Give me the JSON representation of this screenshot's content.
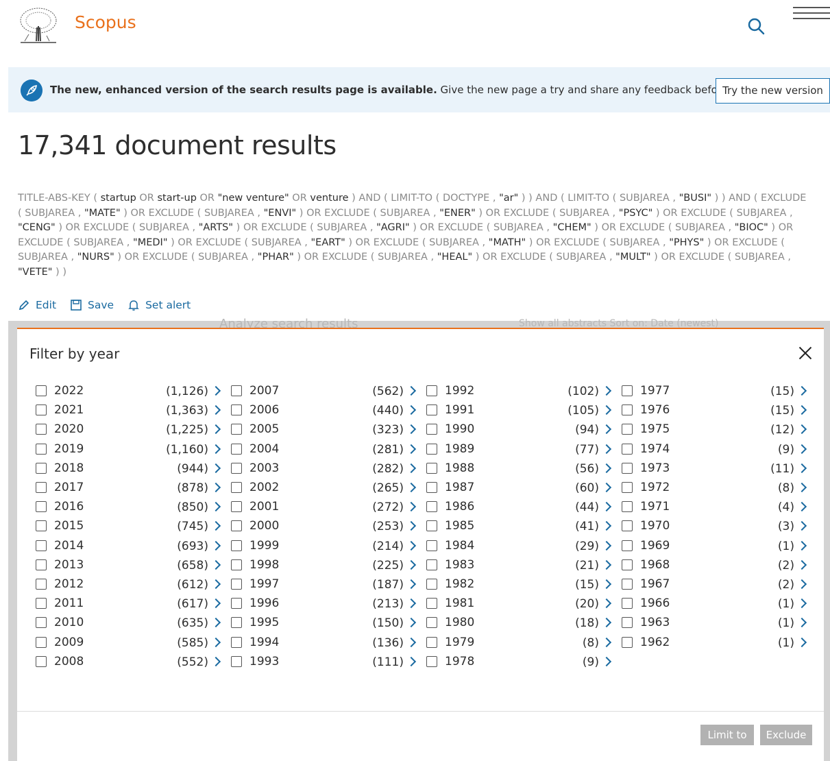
{
  "header": {
    "brand": "Scopus",
    "logo_icon": "elsevier-tree-logo",
    "search_icon": "search-icon",
    "menu_icon": "hamburger-menu-icon"
  },
  "banner": {
    "bold_text": "The new, enhanced version of the search results page is available.",
    "text": " Give the new page a try and share any feedback before it is finalized.",
    "button_label": "Try the new version",
    "icon": "rocket-icon"
  },
  "results": {
    "title": "17,341 document results",
    "query": [
      {
        "t": "TITLE-ABS-KEY ( ",
        "b": false
      },
      {
        "t": "startup",
        "b": true
      },
      {
        "t": "  OR  ",
        "b": false
      },
      {
        "t": "start-up",
        "b": true
      },
      {
        "t": "  OR  ",
        "b": false
      },
      {
        "t": "\"new venture\"",
        "b": true
      },
      {
        "t": "  OR  ",
        "b": false
      },
      {
        "t": "venture",
        "b": true
      },
      {
        "t": " )  AND  ( LIMIT-TO ( DOCTYPE ,  ",
        "b": false
      },
      {
        "t": "\"ar\"",
        "b": true
      },
      {
        "t": " ) )  AND  ( LIMIT-TO ( SUBJAREA ,  ",
        "b": false
      },
      {
        "t": "\"BUSI\"",
        "b": true
      },
      {
        "t": " ) )  AND ( EXCLUDE ( SUBJAREA ,  ",
        "b": false
      },
      {
        "t": "\"MATE\"",
        "b": true
      },
      {
        "t": " )  OR  EXCLUDE ( SUBJAREA ,  ",
        "b": false
      },
      {
        "t": "\"ENVI\"",
        "b": true
      },
      {
        "t": " )  OR  EXCLUDE ( SUBJAREA ,  ",
        "b": false
      },
      {
        "t": "\"ENER\"",
        "b": true
      },
      {
        "t": " )  OR  EXCLUDE ( SUBJAREA ,  ",
        "b": false
      },
      {
        "t": "\"PSYC\"",
        "b": true
      },
      {
        "t": " )  OR EXCLUDE ( SUBJAREA ,  ",
        "b": false
      },
      {
        "t": "\"CENG\"",
        "b": true
      },
      {
        "t": " )  OR  EXCLUDE ( SUBJAREA ,  ",
        "b": false
      },
      {
        "t": "\"ARTS\"",
        "b": true
      },
      {
        "t": " )  OR  EXCLUDE ( SUBJAREA ,  ",
        "b": false
      },
      {
        "t": "\"AGRI\"",
        "b": true
      },
      {
        "t": " )  OR  EXCLUDE ( SUBJAREA ,  ",
        "b": false
      },
      {
        "t": "\"CHEM\"",
        "b": true
      },
      {
        "t": " )  OR EXCLUDE ( SUBJAREA ,  ",
        "b": false
      },
      {
        "t": "\"BIOC\"",
        "b": true
      },
      {
        "t": " )  OR  EXCLUDE ( SUBJAREA ,  ",
        "b": false
      },
      {
        "t": "\"MEDI\"",
        "b": true
      },
      {
        "t": " )  OR  EXCLUDE ( SUBJAREA ,  ",
        "b": false
      },
      {
        "t": "\"EART\"",
        "b": true
      },
      {
        "t": " )  OR  EXCLUDE ( SUBJAREA ,  ",
        "b": false
      },
      {
        "t": "\"MATH\"",
        "b": true
      },
      {
        "t": " )  OR EXCLUDE ( SUBJAREA ,  ",
        "b": false
      },
      {
        "t": "\"PHYS\"",
        "b": true
      },
      {
        "t": " )  OR  EXCLUDE ( SUBJAREA ,  ",
        "b": false
      },
      {
        "t": "\"NURS\"",
        "b": true
      },
      {
        "t": " )  OR  EXCLUDE ( SUBJAREA ,  ",
        "b": false
      },
      {
        "t": "\"PHAR\"",
        "b": true
      },
      {
        "t": " )  OR  EXCLUDE ( SUBJAREA ,  ",
        "b": false
      },
      {
        "t": "\"HEAL\"",
        "b": true
      },
      {
        "t": " )  OR EXCLUDE ( SUBJAREA ,  ",
        "b": false
      },
      {
        "t": "\"MULT\"",
        "b": true
      },
      {
        "t": " )  OR  EXCLUDE ( SUBJAREA ,  ",
        "b": false
      },
      {
        "t": "\"VETE\"",
        "b": true
      },
      {
        "t": " ) )",
        "b": false
      }
    ],
    "actions": [
      {
        "label": "Edit",
        "icon": "pencil-icon"
      },
      {
        "label": "Save",
        "icon": "floppy-disk-icon"
      },
      {
        "label": "Set alert",
        "icon": "bell-icon"
      }
    ],
    "behind_label": "Analyze search results",
    "behind_label_2": "Show all abstracts    Sort on:  Date (newest)"
  },
  "modal": {
    "title": "Filter by year",
    "close_icon": "close-icon",
    "columns": [
      [
        {
          "year": "2022",
          "count": "(1,126)"
        },
        {
          "year": "2021",
          "count": "(1,363)"
        },
        {
          "year": "2020",
          "count": "(1,225)"
        },
        {
          "year": "2019",
          "count": "(1,160)"
        },
        {
          "year": "2018",
          "count": "(944)"
        },
        {
          "year": "2017",
          "count": "(878)"
        },
        {
          "year": "2016",
          "count": "(850)"
        },
        {
          "year": "2015",
          "count": "(745)"
        },
        {
          "year": "2014",
          "count": "(693)"
        },
        {
          "year": "2013",
          "count": "(658)"
        },
        {
          "year": "2012",
          "count": "(612)"
        },
        {
          "year": "2011",
          "count": "(617)"
        },
        {
          "year": "2010",
          "count": "(635)"
        },
        {
          "year": "2009",
          "count": "(585)"
        },
        {
          "year": "2008",
          "count": "(552)"
        }
      ],
      [
        {
          "year": "2007",
          "count": "(562)"
        },
        {
          "year": "2006",
          "count": "(440)"
        },
        {
          "year": "2005",
          "count": "(323)"
        },
        {
          "year": "2004",
          "count": "(281)"
        },
        {
          "year": "2003",
          "count": "(282)"
        },
        {
          "year": "2002",
          "count": "(265)"
        },
        {
          "year": "2001",
          "count": "(272)"
        },
        {
          "year": "2000",
          "count": "(253)"
        },
        {
          "year": "1999",
          "count": "(214)"
        },
        {
          "year": "1998",
          "count": "(225)"
        },
        {
          "year": "1997",
          "count": "(187)"
        },
        {
          "year": "1996",
          "count": "(213)"
        },
        {
          "year": "1995",
          "count": "(150)"
        },
        {
          "year": "1994",
          "count": "(136)"
        },
        {
          "year": "1993",
          "count": "(111)"
        }
      ],
      [
        {
          "year": "1992",
          "count": "(102)"
        },
        {
          "year": "1991",
          "count": "(105)"
        },
        {
          "year": "1990",
          "count": "(94)"
        },
        {
          "year": "1989",
          "count": "(77)"
        },
        {
          "year": "1988",
          "count": "(56)"
        },
        {
          "year": "1987",
          "count": "(60)"
        },
        {
          "year": "1986",
          "count": "(44)"
        },
        {
          "year": "1985",
          "count": "(41)"
        },
        {
          "year": "1984",
          "count": "(29)"
        },
        {
          "year": "1983",
          "count": "(21)"
        },
        {
          "year": "1982",
          "count": "(15)"
        },
        {
          "year": "1981",
          "count": "(20)"
        },
        {
          "year": "1980",
          "count": "(18)"
        },
        {
          "year": "1979",
          "count": "(8)"
        },
        {
          "year": "1978",
          "count": "(9)"
        }
      ],
      [
        {
          "year": "1977",
          "count": "(15)"
        },
        {
          "year": "1976",
          "count": "(15)"
        },
        {
          "year": "1975",
          "count": "(12)"
        },
        {
          "year": "1974",
          "count": "(9)"
        },
        {
          "year": "1973",
          "count": "(11)"
        },
        {
          "year": "1972",
          "count": "(8)"
        },
        {
          "year": "1971",
          "count": "(4)"
        },
        {
          "year": "1970",
          "count": "(3)"
        },
        {
          "year": "1969",
          "count": "(1)"
        },
        {
          "year": "1968",
          "count": "(2)"
        },
        {
          "year": "1967",
          "count": "(2)"
        },
        {
          "year": "1966",
          "count": "(1)"
        },
        {
          "year": "1963",
          "count": "(1)"
        },
        {
          "year": "1962",
          "count": "(1)"
        }
      ]
    ],
    "limit_label": "Limit to",
    "exclude_label": "Exclude"
  },
  "colors": {
    "accent_orange": "#e9711c",
    "link_blue": "#1a6aa0",
    "banner_bg": "#eaf3fa",
    "disabled_button": "#b2b2b2"
  }
}
